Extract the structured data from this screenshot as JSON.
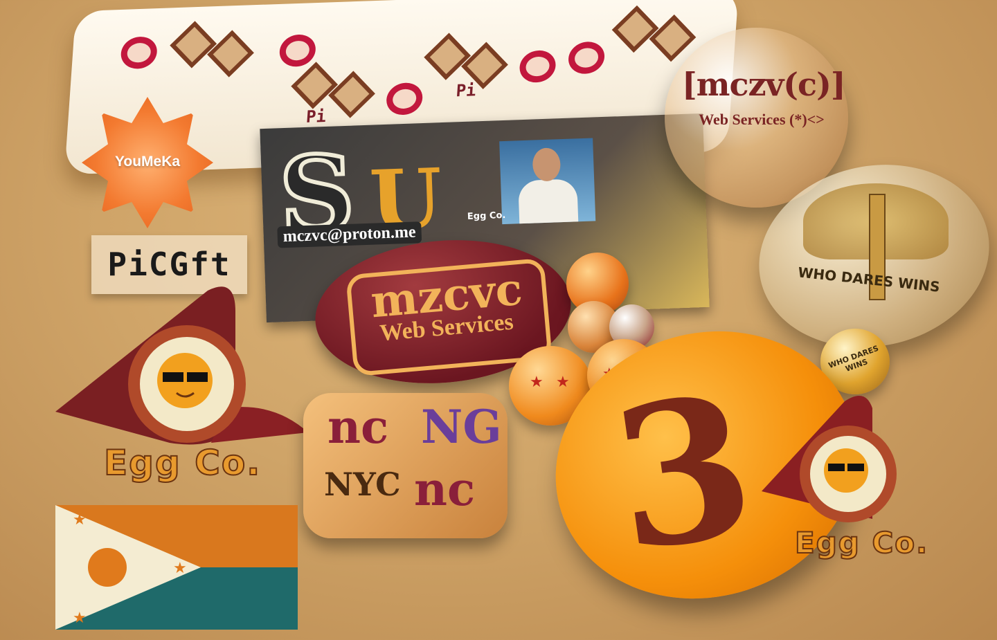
{
  "scene": {
    "banner": {
      "logo_text": "Pi"
    },
    "youmeka": {
      "label": "YouMeKa"
    },
    "picraft": {
      "label": "PiCGft"
    },
    "poster": {
      "email": "mczvc@proton.me",
      "letter_s": "S",
      "letter_u": "U",
      "egg_label": "Egg Co."
    },
    "mzcvc_badge": {
      "title": "mzcvc",
      "subtitle": "Web Services"
    },
    "sphere": {
      "title": "[mczv(c)]",
      "subtitle": "Web Services (*)<>"
    },
    "glass_badge": {
      "motto": "WHO DARES WINS"
    },
    "small_ball": {
      "motto": "WHO DARES WINS"
    },
    "eggco_left": {
      "label": "Egg Co."
    },
    "eggco_right": {
      "label": "Egg Co."
    },
    "nc_tile": {
      "tl": "nc",
      "tr": "NG",
      "bl": "NYC",
      "br": "nc"
    },
    "big_disk": {
      "glyph": "3"
    },
    "colors": {
      "background": "#cfa468",
      "maroon": "#7a2424",
      "orange": "#f58f0a",
      "teal": "#1f6a6a",
      "gold": "#f2b35a"
    }
  }
}
